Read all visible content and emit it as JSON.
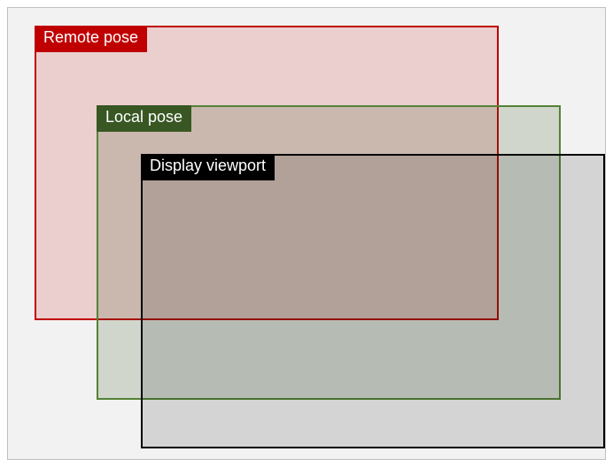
{
  "boxes": {
    "remote": {
      "label": "Remote pose"
    },
    "local": {
      "label": "Local pose"
    },
    "viewport": {
      "label": "Display viewport"
    }
  }
}
